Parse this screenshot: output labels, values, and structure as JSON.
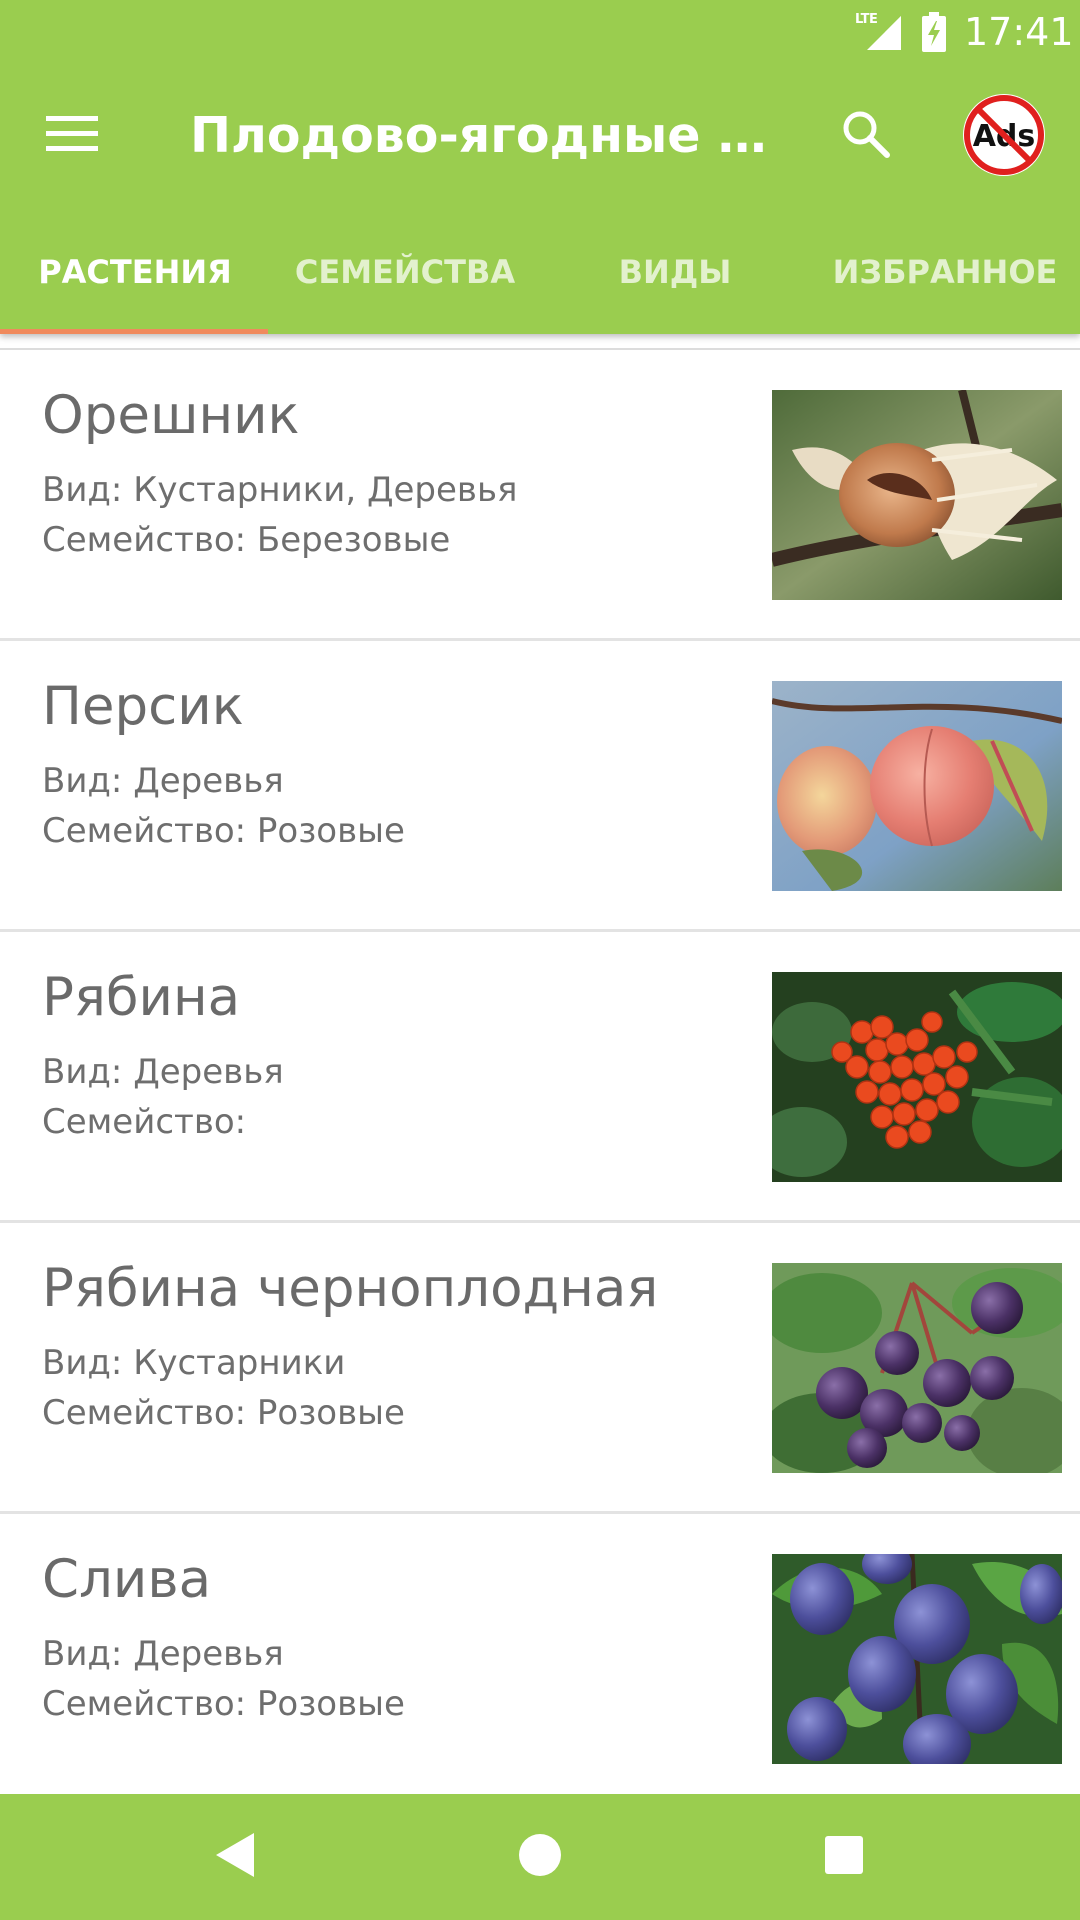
{
  "status_bar": {
    "time": "17:41",
    "network": "LTE",
    "icons": [
      "signal-icon",
      "battery-charging-icon"
    ]
  },
  "toolbar": {
    "title": "Плодово-ягодные рас...",
    "icons": [
      "menu-icon",
      "search-icon",
      "no-ads-icon"
    ],
    "no_ads_text": "Ads"
  },
  "tabs": [
    {
      "label": "РАСТЕНИЯ",
      "active": true
    },
    {
      "label": "СЕМЕЙСТВА",
      "active": false
    },
    {
      "label": "ВИДЫ",
      "active": false
    },
    {
      "label": "ИЗБРАННОЕ",
      "active": false
    }
  ],
  "plants": [
    {
      "name": "Орешник",
      "type": "Вид: Кустарники, Деревья",
      "family": "Семейство: Березовые",
      "photo": "hazelnut-photo"
    },
    {
      "name": "Персик",
      "type": "Вид: Деревья",
      "family": "Семейство: Розовые",
      "photo": "peach-photo"
    },
    {
      "name": "Рябина",
      "type": "Вид: Деревья",
      "family": "Семейство:",
      "photo": "rowan-photo"
    },
    {
      "name": "Рябина черноплодная",
      "type": "Вид: Кустарники",
      "family": "Семейство: Розовые",
      "photo": "chokeberry-photo"
    },
    {
      "name": "Слива",
      "type": "Вид: Деревья",
      "family": "Семейство: Розовые",
      "photo": "plum-photo"
    }
  ],
  "navbar": {
    "icons": [
      "back-icon",
      "home-icon",
      "recents-icon"
    ]
  },
  "colors": {
    "primary": "#9ACD4F",
    "tab_indicator": "#F08A5D",
    "text_secondary": "#6e6e6e"
  }
}
